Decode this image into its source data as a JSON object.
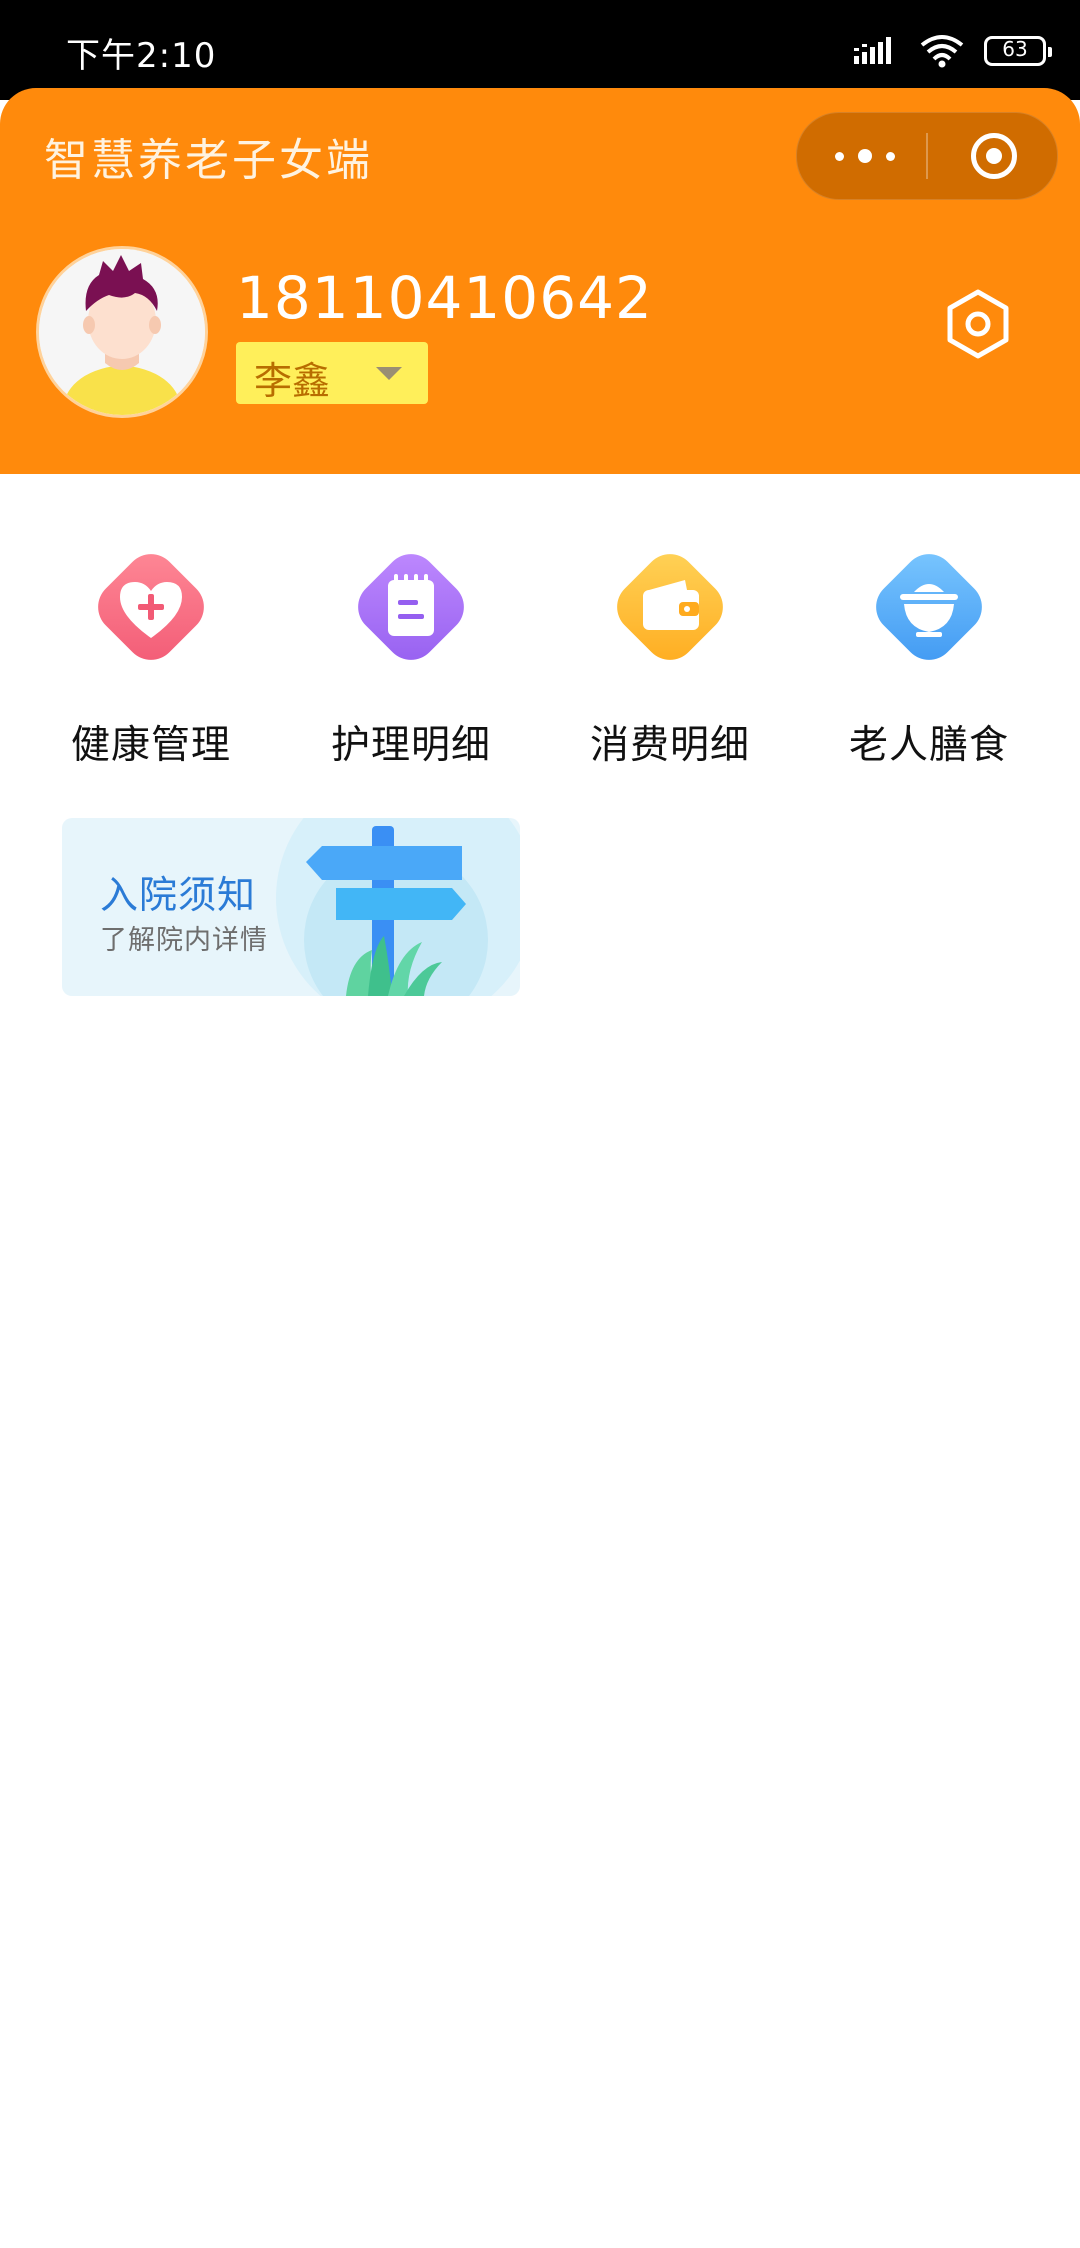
{
  "status_bar": {
    "time": "下午2:10",
    "battery": "63",
    "icons": [
      "signal-icon",
      "wifi-icon",
      "battery-icon"
    ]
  },
  "header": {
    "title": "智慧养老子女端",
    "capsule_icons": [
      "more-icon",
      "close-target-icon"
    ],
    "phone": "18110410642",
    "elder_name": "李鑫",
    "settings_icon": "hexagon-settings-icon",
    "colors": {
      "background": "#ff8a0c",
      "name_select_bg": "#ffef5a"
    }
  },
  "menu": {
    "items": [
      {
        "label": "健康管理",
        "icon": "health-heart-icon",
        "color": "#f7677e"
      },
      {
        "label": "护理明细",
        "icon": "nursing-notepad-icon",
        "color": "#a46df5"
      },
      {
        "label": "消费明细",
        "icon": "wallet-icon",
        "color": "#ffb72a"
      },
      {
        "label": "老人膳食",
        "icon": "meal-bowl-icon",
        "color": "#4aa6f6"
      }
    ]
  },
  "banner": {
    "title": "入院须知",
    "subtitle": "了解院内详情",
    "icon": "signpost-icon"
  }
}
